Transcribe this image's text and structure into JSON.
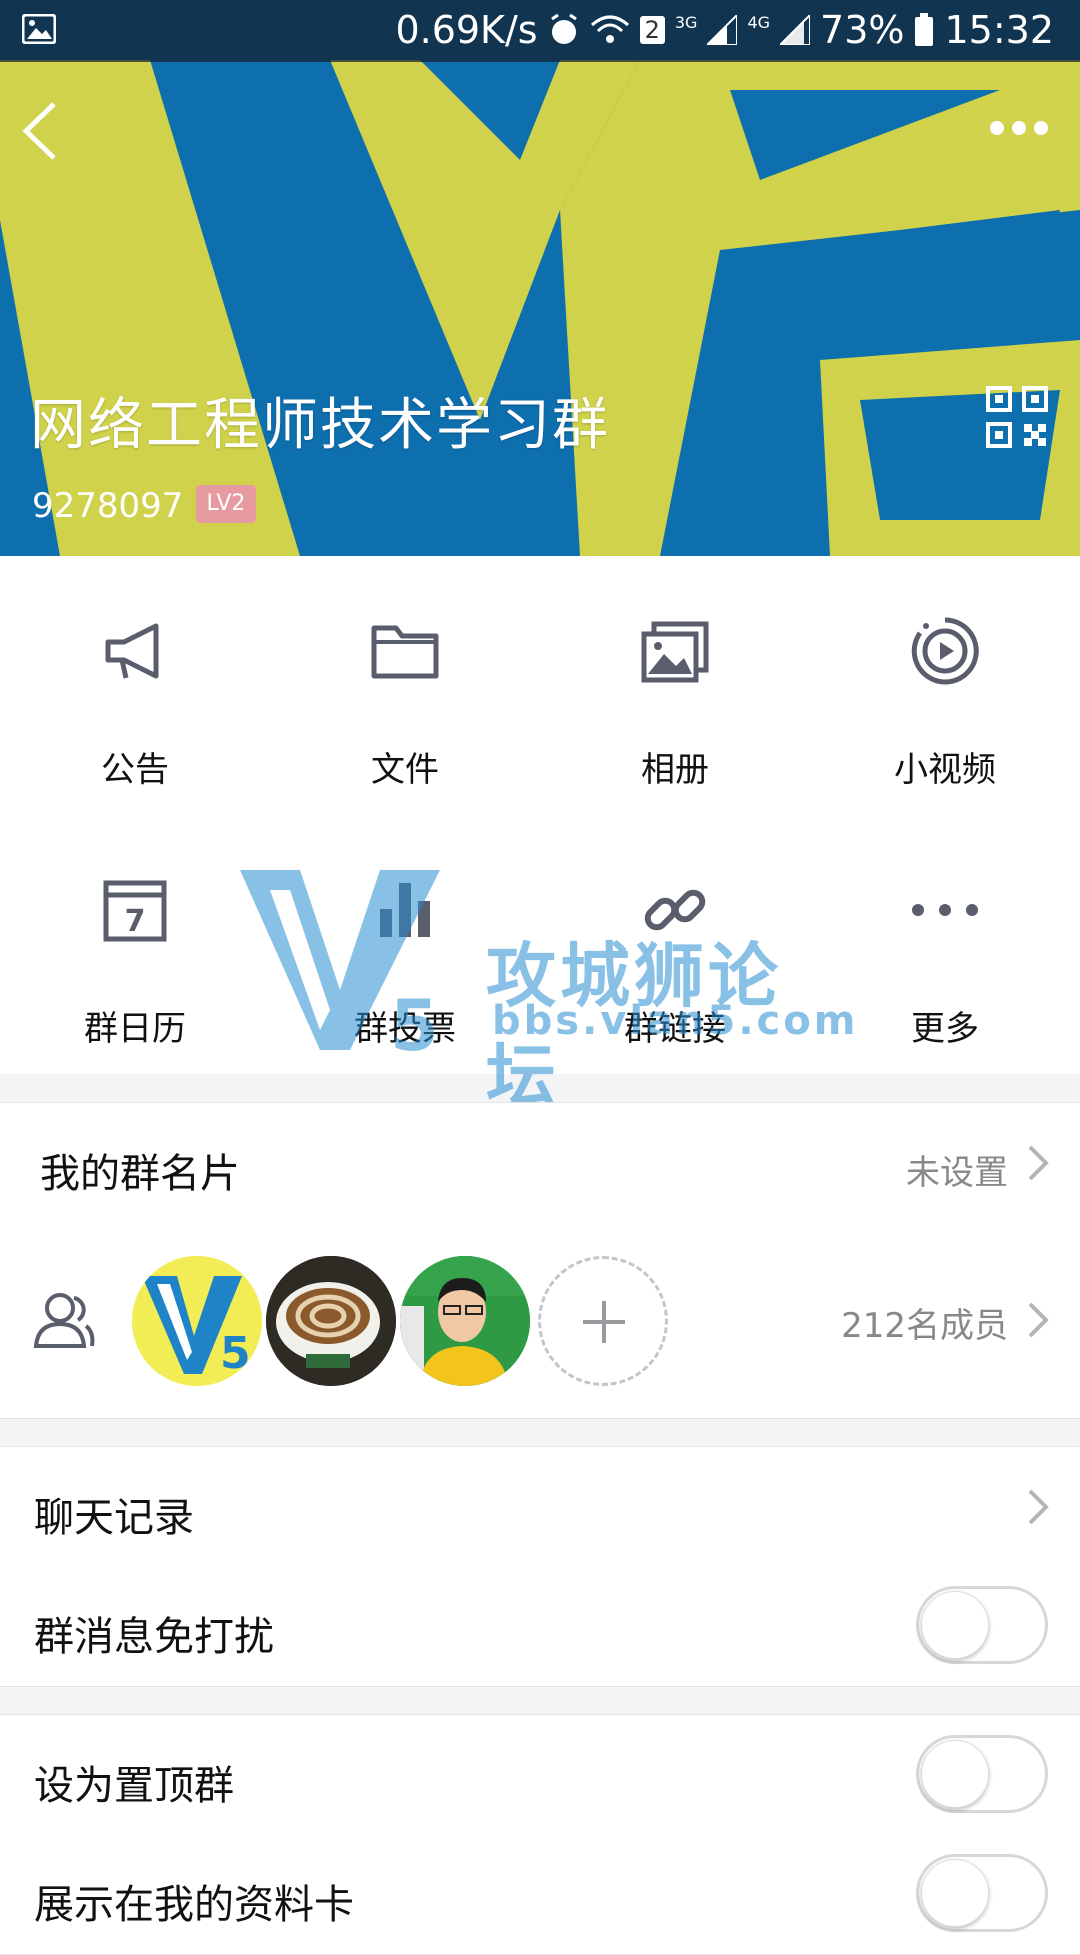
{
  "status_bar": {
    "speed": "0.69K/s",
    "sim_badge": "2",
    "network_3g": "3G",
    "network_4g": "4G",
    "battery": "73%",
    "time": "15:32"
  },
  "header": {
    "group_name": "网络工程师技术学习群",
    "group_id": "9278097",
    "level_badge": "LV2",
    "colors": {
      "blue": "#0e6fae",
      "yellow": "#cfd24a"
    }
  },
  "features": [
    {
      "label": "公告",
      "icon": "megaphone-icon"
    },
    {
      "label": "文件",
      "icon": "folder-icon"
    },
    {
      "label": "相册",
      "icon": "album-icon"
    },
    {
      "label": "小视频",
      "icon": "video-icon"
    },
    {
      "label": "群日历",
      "icon": "calendar-icon",
      "day": "7"
    },
    {
      "label": "群投票",
      "icon": "poll-icon"
    },
    {
      "label": "群链接",
      "icon": "link-icon"
    },
    {
      "label": "更多",
      "icon": "more-icon"
    }
  ],
  "watermark": {
    "title": "攻城狮论坛",
    "url": "bbs.vlan5.com"
  },
  "my_card": {
    "label": "我的群名片",
    "value": "未设置"
  },
  "members": {
    "count_label": "212名成员"
  },
  "chat_history": {
    "label": "聊天记录"
  },
  "toggles": [
    {
      "label": "群消息免打扰",
      "on": false
    },
    {
      "label": "设为置顶群",
      "on": false
    },
    {
      "label": "展示在我的资料卡",
      "on": false
    }
  ]
}
